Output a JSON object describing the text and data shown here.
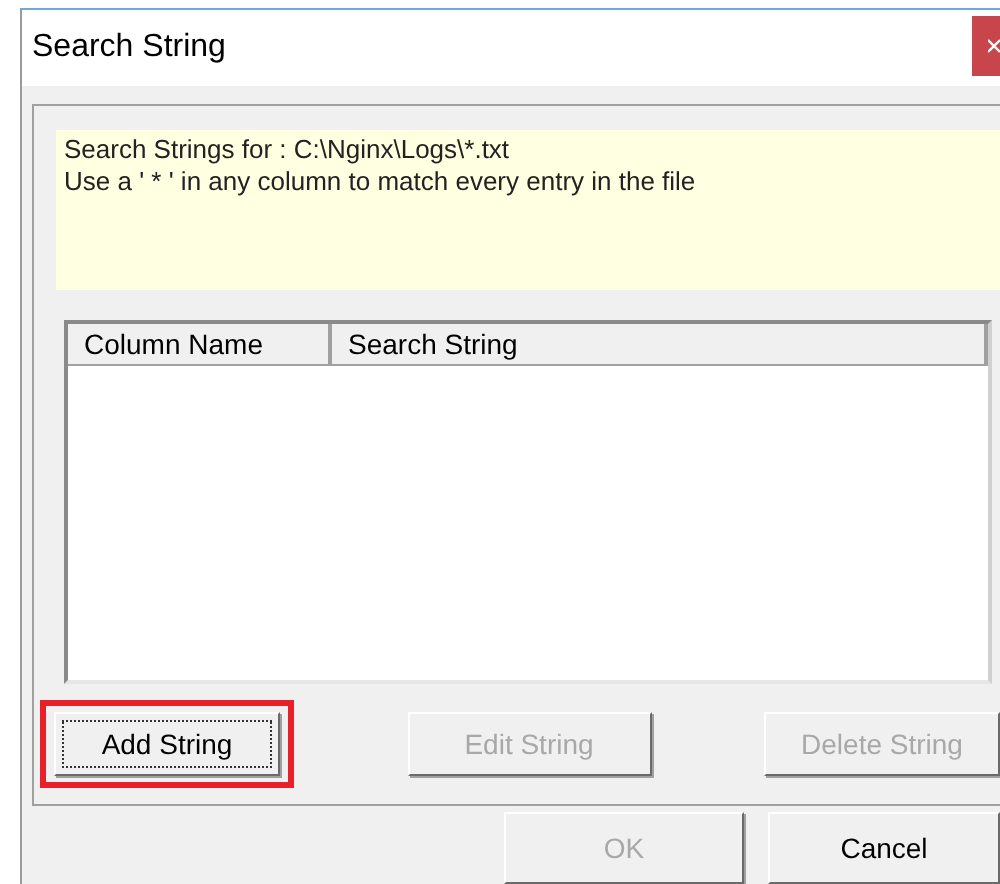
{
  "window": {
    "title": "Search String"
  },
  "note": {
    "lines": [
      "Search Strings for : C:\\Nginx\\Logs\\*.txt",
      "Use a ' * ' in any column to match every entry in the file"
    ]
  },
  "table": {
    "columns": [
      "Column Name",
      "Search String"
    ]
  },
  "buttons": [
    {
      "label": "Add String",
      "disabled": false,
      "focused": true,
      "highlighted": true
    },
    {
      "label": "Edit String",
      "disabled": true,
      "focused": false,
      "highlighted": false
    },
    {
      "label": "Delete String",
      "disabled": true,
      "focused": false,
      "highlighted": false
    }
  ],
  "dialog_buttons": [
    {
      "label": "OK",
      "disabled": true
    },
    {
      "label": "Cancel",
      "disabled": false
    }
  ]
}
